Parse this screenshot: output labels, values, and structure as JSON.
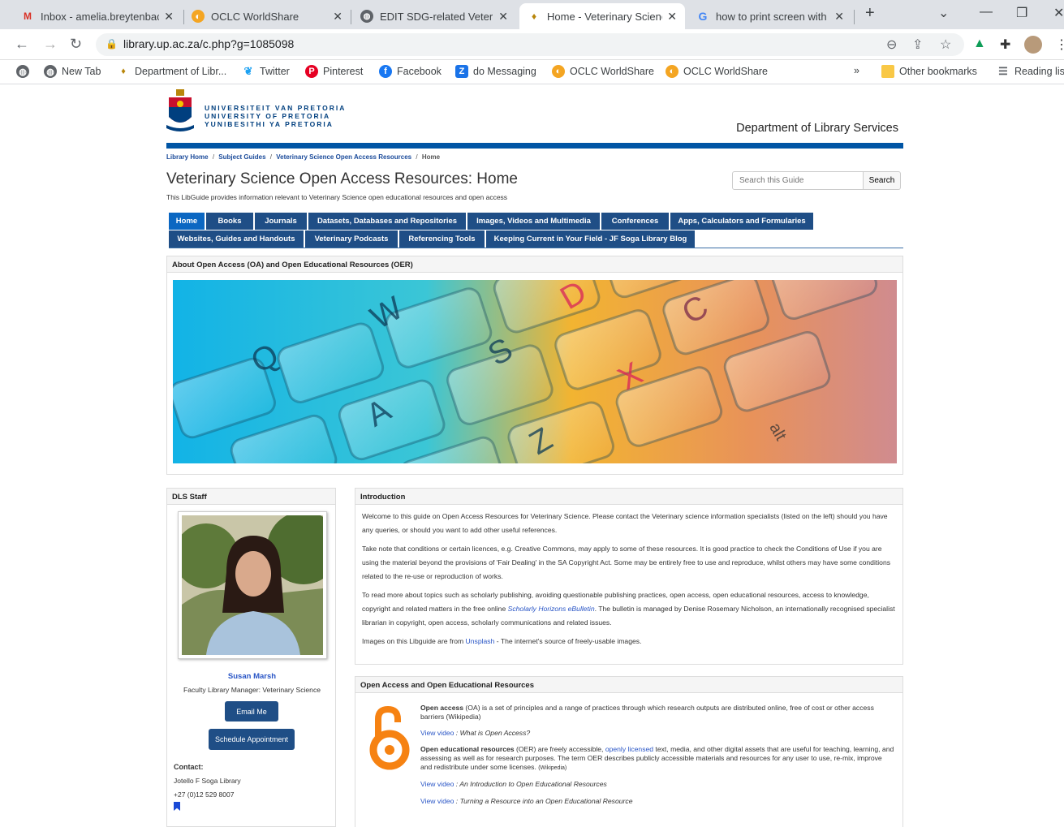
{
  "browser": {
    "tabs": [
      {
        "label": "Inbox - amelia.breytenbac",
        "icon": "gmail-icon",
        "close": "✕"
      },
      {
        "label": "OCLC WorldShare",
        "icon": "oclc-icon",
        "close": "✕"
      },
      {
        "label": "EDIT SDG-related Veterina",
        "icon": "globe-icon",
        "close": "✕"
      },
      {
        "label": "Home - Veterinary Scienc",
        "icon": "up-crest-icon",
        "close": "✕"
      },
      {
        "label": "how to print screen with c",
        "icon": "google-icon",
        "close": "✕"
      }
    ],
    "new_tab": "+",
    "url": "library.up.ac.za/c.php?g=1085098",
    "bookmarks": [
      {
        "label": "New Tab"
      },
      {
        "label": "Department of Libr..."
      },
      {
        "label": "Twitter"
      },
      {
        "label": "Pinterest"
      },
      {
        "label": "Facebook"
      },
      {
        "label": "do Messaging"
      },
      {
        "label": "OCLC WorldShare"
      },
      {
        "label": "OCLC WorldShare"
      }
    ],
    "more": "»",
    "other_bookmarks": "Other bookmarks",
    "reading_list": "Reading lis"
  },
  "header": {
    "uni_line1": "UNIVERSITEIT VAN PRETORIA",
    "uni_line2": "UNIVERSITY OF PRETORIA",
    "uni_line3": "YUNIBESITHI YA PRETORIA",
    "dept": "Department of Library Services"
  },
  "breadcrumbs": [
    "Library Home",
    "Subject Guides",
    "Veterinary Science Open Access Resources",
    "Home"
  ],
  "breadcrumb_sep": "/",
  "guide": {
    "title": "Veterinary Science Open Access Resources: Home",
    "description": "This LibGuide provides information relevant to Veterinary Science open educational resources and open access",
    "search_placeholder": "Search this Guide",
    "search_button": "Search"
  },
  "nav_row1": [
    "Home",
    "Books",
    "Journals",
    "Datasets, Databases and Repositories",
    "Images, Videos and Multimedia",
    "Conferences",
    "Apps, Calculators and Formularies"
  ],
  "nav_row2": [
    "Websites, Guides and Handouts",
    "Veterinary Podcasts",
    "Referencing Tools",
    "Keeping Current in Your Field - JF Soga Library Blog"
  ],
  "about_box": {
    "title": "About Open Access (OA) and Open Educational Resources (OER)"
  },
  "keys": [
    "W",
    "D",
    "C",
    "Q",
    "S",
    "X",
    "A",
    "Z",
    "alt"
  ],
  "staff": {
    "title": "DLS Staff",
    "name": "Susan Marsh",
    "role": "Faculty Library Manager: Veterinary Science",
    "email_btn": "Email Me",
    "schedule_btn": "Schedule Appointment",
    "contact_label": "Contact:",
    "contact_place": "Jotello F Soga Library",
    "contact_phone": "+27 (0)12 529 8007"
  },
  "intro": {
    "title": "Introduction",
    "p1": "Welcome to this guide on Open Access Resources for Veterinary Science. Please contact the Veterinary science information specialists (listed on the left) should you have any queries, or should you want to add other useful references.",
    "p2": "Take note that conditions or certain licences, e.g. Creative Commons, may apply to some of these resources.  It is good practice to check the Conditions of Use if you are using the material beyond the provisions of 'Fair Dealing' in the SA Copyright Act. Some may be entirely free to use and reproduce, whilst others may have some conditions related to the re-use or reproduction of works.",
    "p3a": "To read more about  topics such as scholarly publishing, avoiding questionable publishing practices, open access, open educational resources, access to knowledge, copyright and related matters in the free online ",
    "p3link": "Scholarly Horizons eBulletin",
    "p3b": ". The bulletin is managed by Denise Rosemary Nicholson, an internationally recognised specialist librarian in copyright, open access, scholarly communications and related issues.",
    "p4a": "Images on this Libguide are from ",
    "p4link": "Unsplash",
    "p4b": " - The internet's source of freely-usable images."
  },
  "oa": {
    "title": "Open Access and Open Educational Resources",
    "oa_term": "Open access",
    "oa_text": " (OA) is a set of principles and a range of practices through which research outputs are distributed online, free of cost or other access barriers (Wikipedia)",
    "video1_link": "View video",
    "video1_title": " : What is Open Access?",
    "oer_term": "Open educational resources",
    "oer_text1": " (OER) are freely accessible, ",
    "oer_link": "openly licensed",
    "oer_text2": " text, media, and other digital assets that are useful for teaching, learning, and assessing as well as for research purposes. The term OER describes publicly accessible materials and resources for any user to use, re-mix, improve and redistribute under some licenses. ",
    "oer_wiki": "(Wikipedia)",
    "video2_link": "View video",
    "video2_title": " : An Introduction to Open Educational Resources",
    "video3_link": "View video",
    "video3_title": " : Turning a Resource into an Open Educational Resource"
  }
}
